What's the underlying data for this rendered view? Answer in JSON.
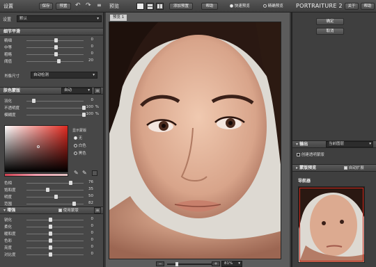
{
  "topbar": {
    "settings_title": "设置",
    "save_label": "保存",
    "preset_label": "预置",
    "preview_title": "预览",
    "add_preset_label": "添加预置",
    "help_label": "帮助",
    "fast_preview_label": "快速预览",
    "precise_preview_label": "精确预览",
    "app_title": "PORTRAITURE 2",
    "about_label": "关于",
    "help2_label": "帮助"
  },
  "left": {
    "preset_label": "设置",
    "preset_value": "默认",
    "detail_section": "细节平滑",
    "detail_rows": [
      {
        "label": "精细",
        "value": "0"
      },
      {
        "label": "中等",
        "value": "0"
      },
      {
        "label": "粗略",
        "value": "0"
      },
      {
        "label": "阈值",
        "value": "20"
      }
    ],
    "detail_row_levels": [
      0.5,
      0.5,
      0.5,
      0.55
    ],
    "size_label": "肖像尺寸",
    "size_value": "自动检测",
    "mask_section": "肤色蒙版",
    "mask_mode": "自动",
    "mask_rows": [
      {
        "label": "羽化",
        "value": "0",
        "unit": ""
      },
      {
        "label": "不透明度",
        "value": "100",
        "unit": "%"
      },
      {
        "label": "模糊度",
        "value": "100",
        "unit": "%"
      }
    ],
    "mask_row_levels": [
      0.1,
      1.0,
      1.0
    ],
    "show_mask_label": "显示蒙版",
    "show_mask_options": [
      "无",
      "白色",
      "黑色"
    ],
    "color_rows": [
      {
        "label": "色相",
        "value": "76"
      },
      {
        "label": "饱和度",
        "value": "35"
      },
      {
        "label": "明度",
        "value": "50"
      },
      {
        "label": "范围",
        "value": "82"
      }
    ],
    "color_row_levels": [
      0.76,
      0.35,
      0.5,
      0.82
    ],
    "enhance_section": "增强",
    "use_mask_label": "使用蒙版",
    "enhance_rows": [
      {
        "label": "锐化",
        "value": "0"
      },
      {
        "label": "柔化",
        "value": "0"
      },
      {
        "label": "暖和度",
        "value": "0"
      },
      {
        "label": "色彩",
        "value": "0"
      },
      {
        "label": "亮度",
        "value": "0"
      },
      {
        "label": "对比度",
        "value": "0"
      }
    ],
    "enhance_row_levels": [
      0.4,
      0.4,
      0.4,
      0.4,
      0.4,
      0.4
    ]
  },
  "center": {
    "tab_label": "预览 1",
    "zoom_value": "81%"
  },
  "right": {
    "ok_label": "确定",
    "cancel_label": "取消",
    "output_section": "输出",
    "output_value": "当前图层",
    "transparent_mask_label": "创建透明蒙版",
    "mask_preview_section": "蒙版预览",
    "auto_expand_label": "自动扩展",
    "navigator_label": "导航器"
  },
  "colors": {
    "accent_red": "#c8281e",
    "panel": "#474747"
  }
}
